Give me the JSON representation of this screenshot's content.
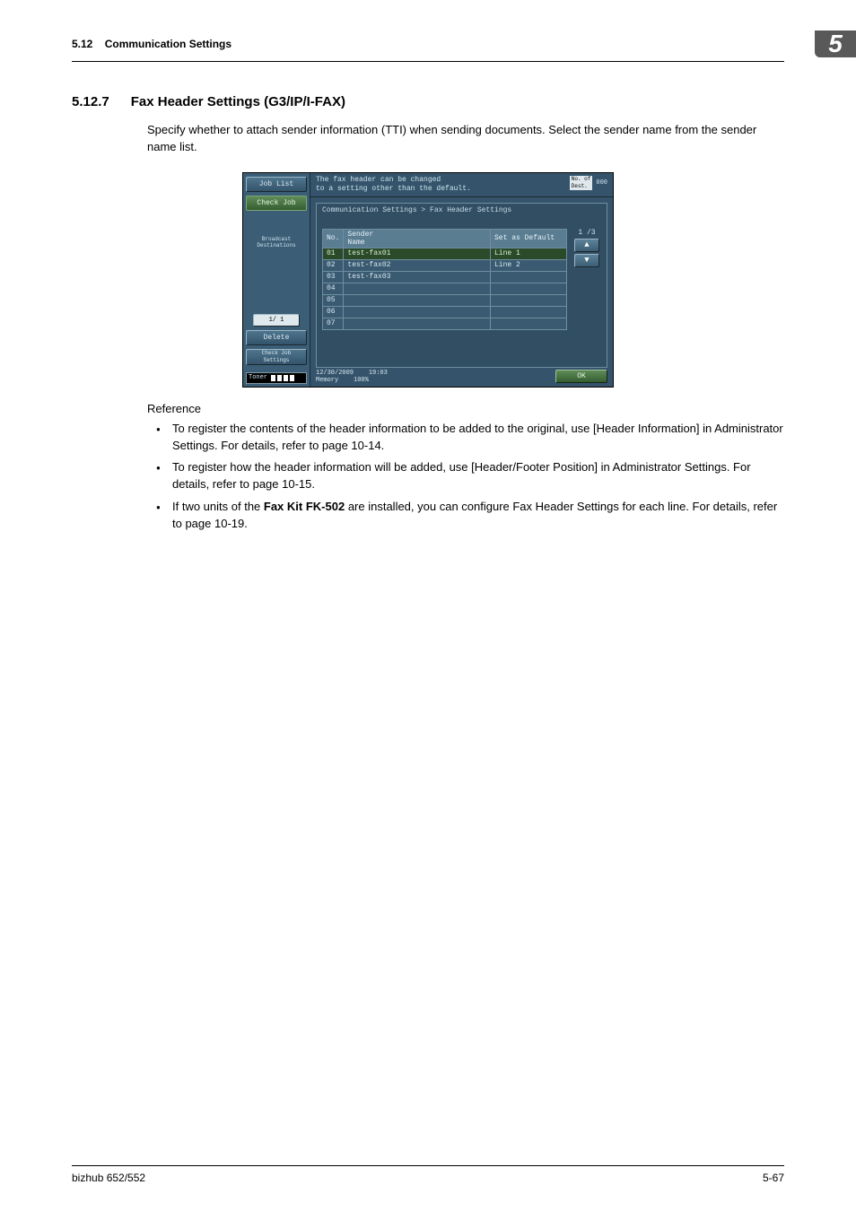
{
  "header": {
    "section_ref": "5.12",
    "section_title": "Communication Settings",
    "chapter": "5"
  },
  "heading": {
    "num": "5.12.7",
    "title": "Fax Header Settings (G3/IP/I-FAX)"
  },
  "intro": "Specify whether to attach sender information (TTI) when sending documents. Select the sender name from the sender name list.",
  "device": {
    "left": {
      "job_list": "Job List",
      "check_job": "Check Job",
      "broadcast": "Broadcast\nDestinations",
      "page": "1/  1",
      "delete": "Delete",
      "check_set": "Check Job\nSettings",
      "toner": "Toner"
    },
    "top": {
      "line1": "The fax header can be changed",
      "line2": "to a setting other than the default.",
      "count_label": "No. of\nDest.",
      "count_value": "000"
    },
    "crumb": "Communication Settings > Fax Header Settings",
    "cols": {
      "no": "No.",
      "name": "Sender\nName",
      "def": "Set as Default"
    },
    "rows": [
      {
        "no": "01",
        "name": "test-fax01",
        "def": "Line 1",
        "sel": true
      },
      {
        "no": "02",
        "name": "test-fax02",
        "def": "Line 2",
        "sel": false
      },
      {
        "no": "03",
        "name": "test-fax03",
        "def": "",
        "sel": false
      },
      {
        "no": "04",
        "name": "",
        "def": "",
        "sel": false
      },
      {
        "no": "05",
        "name": "",
        "def": "",
        "sel": false
      },
      {
        "no": "06",
        "name": "",
        "def": "",
        "sel": false
      },
      {
        "no": "07",
        "name": "",
        "def": "",
        "sel": false
      }
    ],
    "page_ind": "1 /3",
    "bottom": {
      "date": "12/30/2009",
      "time": "19:03",
      "mem_lbl": "Memory",
      "mem_val": "100%",
      "ok": "OK"
    }
  },
  "reference": {
    "label": "Reference",
    "items": [
      "To register the contents of the header information to be added to the original, use [Header Information] in Administrator Settings. For details, refer to page 10-14.",
      "To register how the header information will be added, use [Header/Footer Position] in Administrator Settings. For details, refer to page 10-15.",
      "If two units of the <b>Fax Kit FK-502</b> are installed, you can configure Fax Header Settings for each line. For details, refer to page 10-19."
    ]
  },
  "footer": {
    "left": "bizhub 652/552",
    "right": "5-67"
  }
}
